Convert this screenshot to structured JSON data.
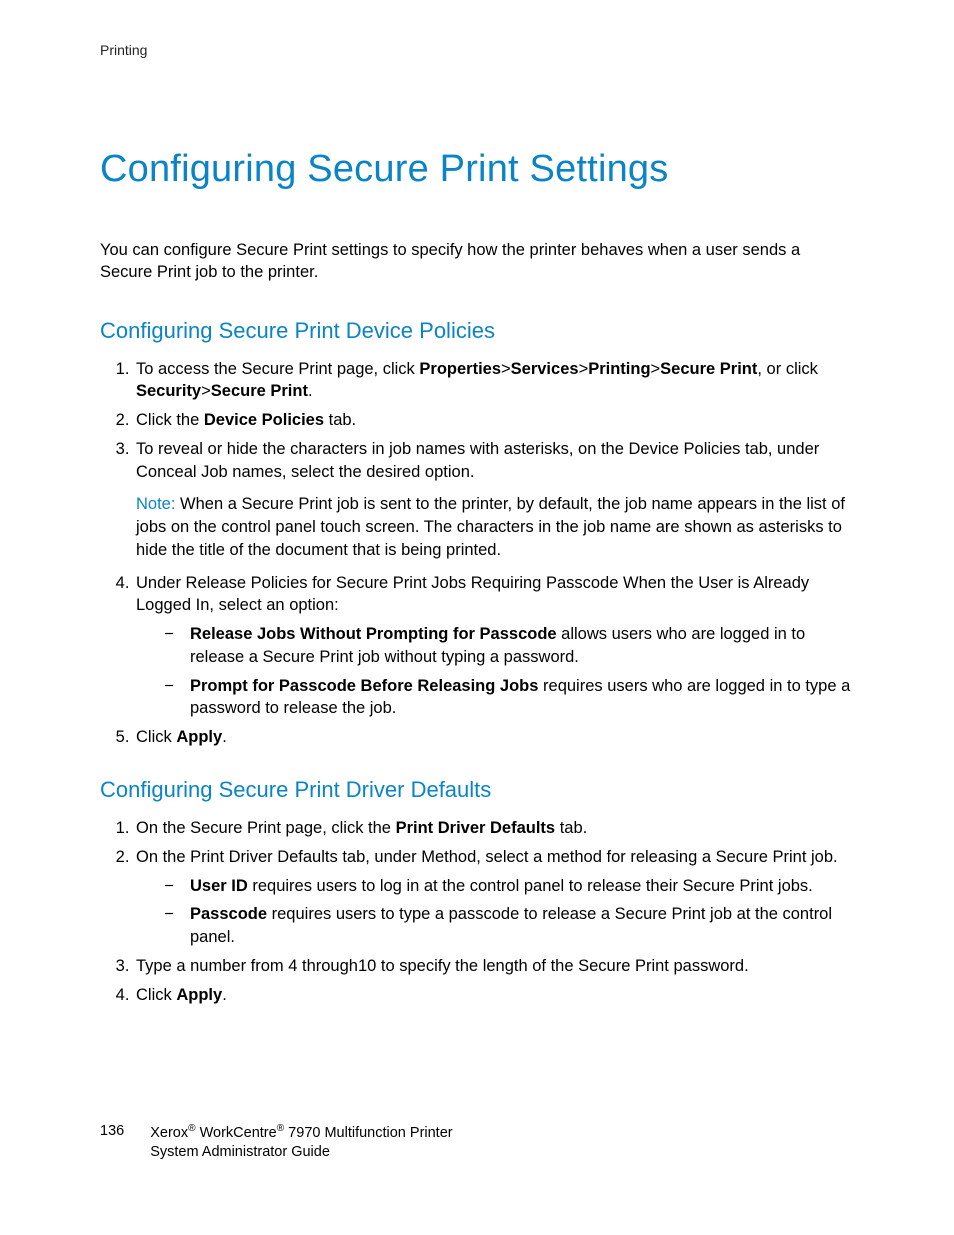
{
  "runningHeader": "Printing",
  "title": "Configuring Secure Print Settings",
  "intro": "You can configure Secure Print settings to specify how the printer behaves when a user sends a Secure Print job to the printer.",
  "section1": {
    "heading": "Configuring Secure Print Device Policies",
    "step1_pre": "To access the Secure Print page, click ",
    "step1_bold1": "Properties",
    "step1_mid1": ">",
    "step1_bold2": "Services",
    "step1_mid2": ">",
    "step1_bold3": "Printing",
    "step1_mid3": ">",
    "step1_bold4": "Secure Print",
    "step1_mid4": ", or click ",
    "step1_bold5": "Security",
    "step1_mid5": ">",
    "step1_bold6": "Secure Print",
    "step1_post": ".",
    "step2_pre": "Click the ",
    "step2_bold": "Device Policies",
    "step2_post": " tab.",
    "step3": "To reveal or hide the characters in job names with asterisks, on the Device Policies tab, under Conceal Job names, select the desired option.",
    "noteLabel": "Note:",
    "noteText": " When a Secure Print job is sent to the printer, by default, the job name appears in the list of jobs on the control panel touch screen. The characters in the job name are shown as asterisks to hide the title of the document that is being printed.",
    "step4": "Under Release Policies for Secure Print Jobs Requiring Passcode When the User is Already Logged In, select an option:",
    "step4a_bold": "Release Jobs Without Prompting for Passcode",
    "step4a_rest": " allows users who are logged in to release a Secure Print job without typing a password.",
    "step4b_bold": "Prompt for Passcode Before Releasing Jobs",
    "step4b_rest": " requires users who are logged in to type a password to release the job.",
    "step5_pre": "Click ",
    "step5_bold": "Apply",
    "step5_post": "."
  },
  "section2": {
    "heading": "Configuring Secure Print Driver Defaults",
    "step1_pre": "On the Secure Print page, click the ",
    "step1_bold": "Print Driver Defaults",
    "step1_post": " tab.",
    "step2": "On the Print Driver Defaults tab, under Method, select a method for releasing a Secure Print job.",
    "step2a_bold": "User ID",
    "step2a_rest": " requires users to log in at the control panel to release their Secure Print jobs.",
    "step2b_bold": "Passcode",
    "step2b_rest": " requires users to type a passcode to release a Secure Print job at the control panel.",
    "step3": "Type a number from 4 through10 to specify the length of the Secure Print password.",
    "step4_pre": "Click ",
    "step4_bold": "Apply",
    "step4_post": "."
  },
  "footer": {
    "pageNumber": "136",
    "brand": "Xerox",
    "reg1": "®",
    "product": " WorkCentre",
    "reg2": "®",
    "model": " 7970 Multifunction Printer",
    "line2": "System Administrator Guide"
  }
}
